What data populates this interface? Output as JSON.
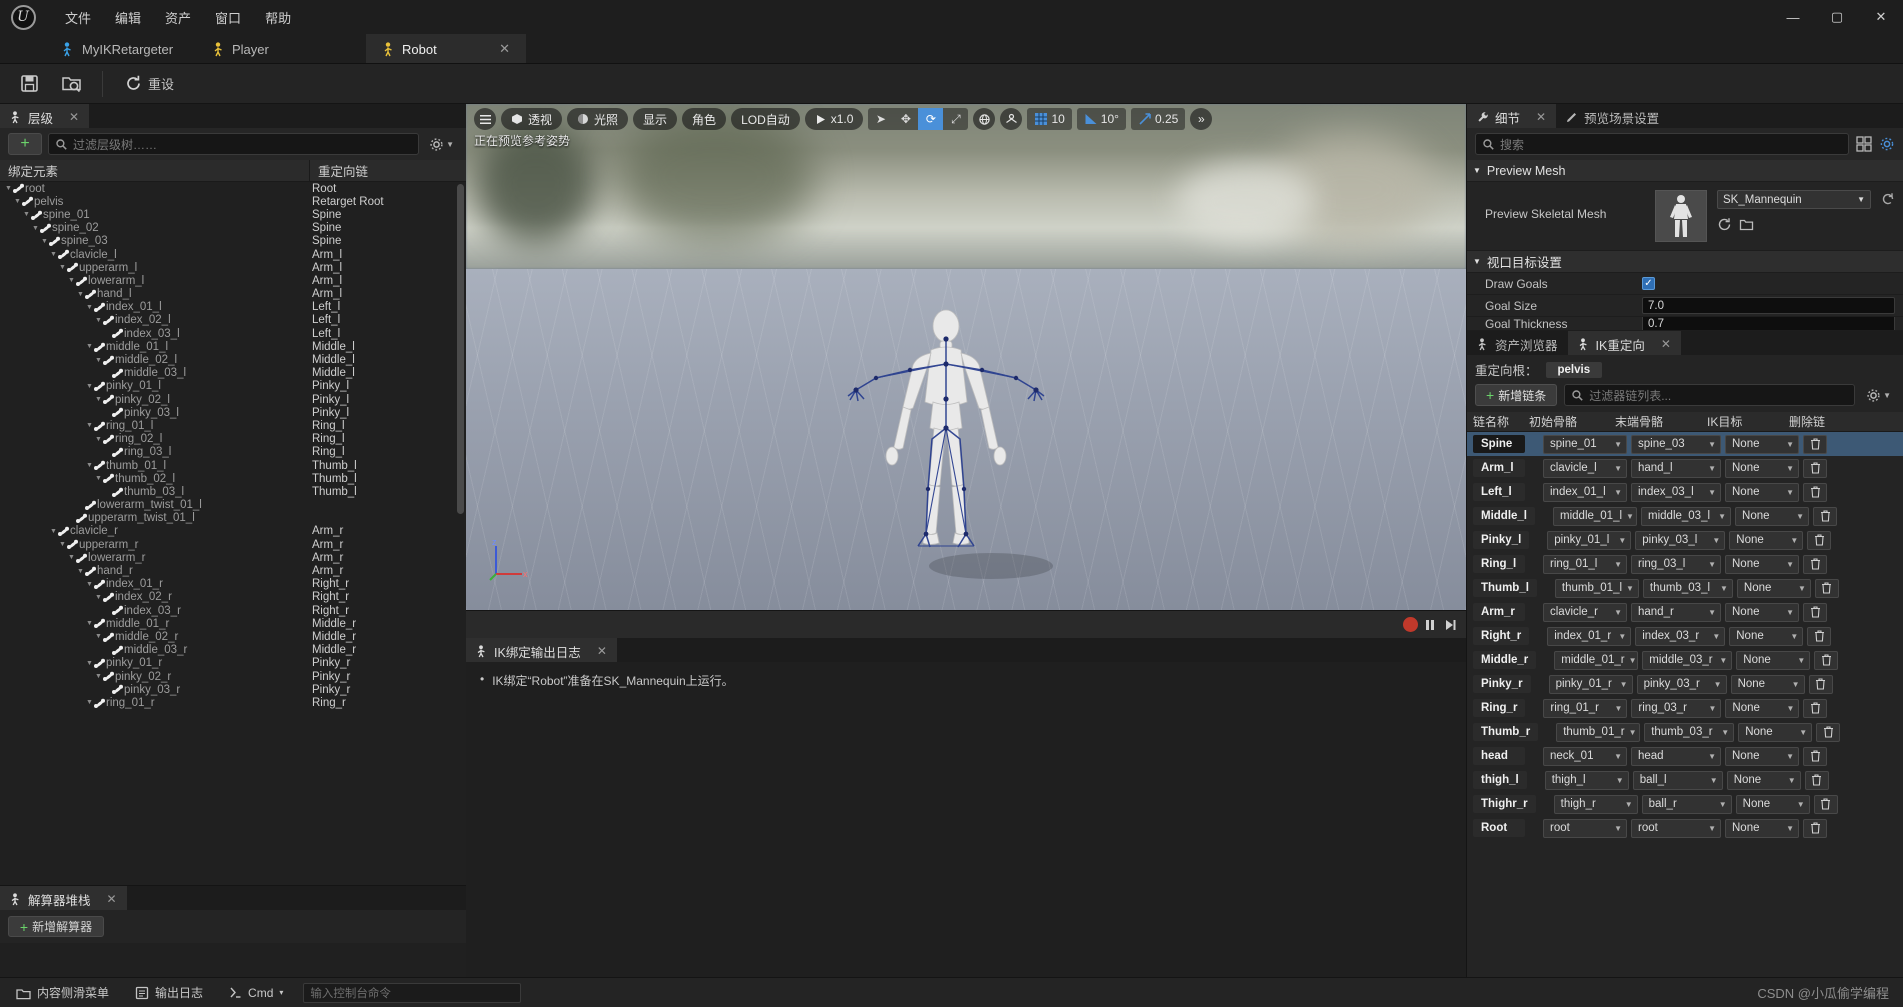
{
  "window": {
    "minimize": "—",
    "maximize": "▢",
    "close": "✕"
  },
  "menu": {
    "items": [
      {
        "label": "文件",
        "name": "menu-file"
      },
      {
        "label": "编辑",
        "name": "menu-edit"
      },
      {
        "label": "资产",
        "name": "menu-asset"
      },
      {
        "label": "窗口",
        "name": "menu-window"
      },
      {
        "label": "帮助",
        "name": "menu-help"
      }
    ]
  },
  "editor_tabs": [
    {
      "label": "MyIKRetargeter",
      "icon": "person-blue-icon",
      "active": false,
      "color": "#3aa2e8"
    },
    {
      "label": "Player",
      "icon": "person-yellow-icon",
      "active": false,
      "color": "#e8c13a"
    },
    {
      "label": "Robot",
      "icon": "person-yellow-icon",
      "active": true,
      "color": "#e8c13a",
      "close": "✕"
    }
  ],
  "toolbar": {
    "save_icon": "save-icon",
    "browse_icon": "browse-content-icon",
    "reset_label": "重设",
    "reset_icon": "refresh-icon"
  },
  "hierarchy": {
    "tab_label": "层级",
    "tab_close": "✕",
    "add_label": "+",
    "filter_placeholder": "过滤层级树……",
    "settings_icon": "gear-icon",
    "columns": {
      "element": "绑定元素",
      "chain": "重定向链"
    },
    "rows": [
      {
        "depth": 0,
        "name": "root",
        "chain": "Root",
        "expandable": true
      },
      {
        "depth": 1,
        "name": "pelvis",
        "chain": "Retarget Root",
        "expandable": true
      },
      {
        "depth": 2,
        "name": "spine_01",
        "chain": "Spine",
        "expandable": true
      },
      {
        "depth": 3,
        "name": "spine_02",
        "chain": "Spine",
        "expandable": true
      },
      {
        "depth": 4,
        "name": "spine_03",
        "chain": "Spine",
        "expandable": true
      },
      {
        "depth": 5,
        "name": "clavicle_l",
        "chain": "Arm_l",
        "expandable": true
      },
      {
        "depth": 6,
        "name": "upperarm_l",
        "chain": "Arm_l",
        "expandable": true
      },
      {
        "depth": 7,
        "name": "lowerarm_l",
        "chain": "Arm_l",
        "expandable": true
      },
      {
        "depth": 8,
        "name": "hand_l",
        "chain": "Arm_l",
        "expandable": true
      },
      {
        "depth": 9,
        "name": "index_01_l",
        "chain": "Left_l",
        "expandable": true
      },
      {
        "depth": 10,
        "name": "index_02_l",
        "chain": "Left_l",
        "expandable": true
      },
      {
        "depth": 11,
        "name": "index_03_l",
        "chain": "Left_l",
        "expandable": false
      },
      {
        "depth": 9,
        "name": "middle_01_l",
        "chain": "Middle_l",
        "expandable": true
      },
      {
        "depth": 10,
        "name": "middle_02_l",
        "chain": "Middle_l",
        "expandable": true
      },
      {
        "depth": 11,
        "name": "middle_03_l",
        "chain": "Middle_l",
        "expandable": false
      },
      {
        "depth": 9,
        "name": "pinky_01_l",
        "chain": "Pinky_l",
        "expandable": true
      },
      {
        "depth": 10,
        "name": "pinky_02_l",
        "chain": "Pinky_l",
        "expandable": true
      },
      {
        "depth": 11,
        "name": "pinky_03_l",
        "chain": "Pinky_l",
        "expandable": false
      },
      {
        "depth": 9,
        "name": "ring_01_l",
        "chain": "Ring_l",
        "expandable": true
      },
      {
        "depth": 10,
        "name": "ring_02_l",
        "chain": "Ring_l",
        "expandable": true
      },
      {
        "depth": 11,
        "name": "ring_03_l",
        "chain": "Ring_l",
        "expandable": false
      },
      {
        "depth": 9,
        "name": "thumb_01_l",
        "chain": "Thumb_l",
        "expandable": true
      },
      {
        "depth": 10,
        "name": "thumb_02_l",
        "chain": "Thumb_l",
        "expandable": true
      },
      {
        "depth": 11,
        "name": "thumb_03_l",
        "chain": "Thumb_l",
        "expandable": false
      },
      {
        "depth": 8,
        "name": "lowerarm_twist_01_l",
        "chain": "",
        "expandable": false
      },
      {
        "depth": 7,
        "name": "upperarm_twist_01_l",
        "chain": "",
        "expandable": false
      },
      {
        "depth": 5,
        "name": "clavicle_r",
        "chain": "Arm_r",
        "expandable": true
      },
      {
        "depth": 6,
        "name": "upperarm_r",
        "chain": "Arm_r",
        "expandable": true
      },
      {
        "depth": 7,
        "name": "lowerarm_r",
        "chain": "Arm_r",
        "expandable": true
      },
      {
        "depth": 8,
        "name": "hand_r",
        "chain": "Arm_r",
        "expandable": true
      },
      {
        "depth": 9,
        "name": "index_01_r",
        "chain": "Right_r",
        "expandable": true
      },
      {
        "depth": 10,
        "name": "index_02_r",
        "chain": "Right_r",
        "expandable": true
      },
      {
        "depth": 11,
        "name": "index_03_r",
        "chain": "Right_r",
        "expandable": false
      },
      {
        "depth": 9,
        "name": "middle_01_r",
        "chain": "Middle_r",
        "expandable": true
      },
      {
        "depth": 10,
        "name": "middle_02_r",
        "chain": "Middle_r",
        "expandable": true
      },
      {
        "depth": 11,
        "name": "middle_03_r",
        "chain": "Middle_r",
        "expandable": false
      },
      {
        "depth": 9,
        "name": "pinky_01_r",
        "chain": "Pinky_r",
        "expandable": true
      },
      {
        "depth": 10,
        "name": "pinky_02_r",
        "chain": "Pinky_r",
        "expandable": true
      },
      {
        "depth": 11,
        "name": "pinky_03_r",
        "chain": "Pinky_r",
        "expandable": false
      },
      {
        "depth": 9,
        "name": "ring_01_r",
        "chain": "Ring_r",
        "expandable": true
      }
    ]
  },
  "solver_stack": {
    "tab_label": "解算器堆栈",
    "tab_close": "✕",
    "add_solver_label": "新增解算器",
    "add_solver_icon": "plus-icon"
  },
  "viewport": {
    "status_text": "正在预览参考姿势",
    "menu_icon": "hamburger-icon",
    "perspective_label": "透视",
    "perspective_icon": "cube-icon",
    "lighting_label": "光照",
    "lighting_icon": "sphere-icon",
    "show_label": "显示",
    "character_label": "角色",
    "lod_label": "LOD自动",
    "play_rate": "x1.0",
    "play_icon": "play-icon",
    "gizmos": [
      {
        "name": "select-tool",
        "glyph": "➤",
        "active": false
      },
      {
        "name": "translate-tool",
        "glyph": "✥",
        "active": false
      },
      {
        "name": "rotate-tool",
        "glyph": "⟳",
        "active": true
      },
      {
        "name": "scale-tool",
        "glyph": "⤢",
        "active": false
      }
    ],
    "coord-space-icon": "globe-icon",
    "surface-snap-icon": "surface-snap-icon",
    "grid_snap_icon": "grid-icon",
    "grid_snap_value": "10",
    "rot_snap_icon": "angle-icon",
    "rot_snap_value": "10°",
    "scale_snap_icon": "scale-icon",
    "scale_snap_value": "0.25",
    "overflow": "»",
    "axis_x": "x",
    "axis_y": "",
    "axis_z": "z",
    "record_icon": "record-icon",
    "pause_icon": "pause-icon",
    "step_icon": "step-forward-icon"
  },
  "log": {
    "tab_label": "IK绑定输出日志",
    "tab_close": "✕",
    "entries": [
      "IK绑定“Robot”准备在SK_Mannequin上运行。"
    ]
  },
  "details": {
    "tab_label": "细节",
    "tab_close": "✕",
    "preview_tab_label": "预览场景设置",
    "search_placeholder": "搜索",
    "grid_icon": "grid-view-icon",
    "settings_icon": "settings-icon",
    "sections": [
      {
        "title": "Preview Mesh",
        "mesh_label": "Preview Skeletal Mesh",
        "mesh_value": "SK_Mannequin",
        "browse_icon": "browse-icon",
        "use_selected_icon": "use-selected-icon",
        "reset_icon": "reset-arrow-icon"
      },
      {
        "title": "视口目标设置",
        "rows": [
          {
            "label": "Draw Goals",
            "type": "checkbox",
            "value": "✓"
          },
          {
            "label": "Goal Size",
            "type": "text",
            "value": "7.0"
          },
          {
            "label": "Goal Thickness",
            "type": "text",
            "value": "0.7"
          }
        ]
      }
    ]
  },
  "chains": {
    "asset_browser_tab": "资产浏览器",
    "ik_retarget_tab": "IK重定向",
    "ik_retarget_tab_close": "✕",
    "retarget_root_label": "重定向根：",
    "retarget_root_value": "pelvis",
    "add_chain_label": "新增链条",
    "add_chain_icon": "plus-icon",
    "filter_placeholder": "过滤器链列表...",
    "settings_icon": "gear-icon",
    "columns": [
      "链名称",
      "初始骨骼",
      "末端骨骼",
      "IK目标",
      "删除链"
    ],
    "rows": [
      {
        "name": "Spine",
        "start": "spine_01",
        "end": "spine_03",
        "goal": "None",
        "selected": true
      },
      {
        "name": "Arm_l",
        "start": "clavicle_l",
        "end": "hand_l",
        "goal": "None",
        "selected": false
      },
      {
        "name": "Left_l",
        "start": "index_01_l",
        "end": "index_03_l",
        "goal": "None",
        "selected": false
      },
      {
        "name": "Middle_l",
        "start": "middle_01_l",
        "end": "middle_03_l",
        "goal": "None",
        "selected": false
      },
      {
        "name": "Pinky_l",
        "start": "pinky_01_l",
        "end": "pinky_03_l",
        "goal": "None",
        "selected": false
      },
      {
        "name": "Ring_l",
        "start": "ring_01_l",
        "end": "ring_03_l",
        "goal": "None",
        "selected": false
      },
      {
        "name": "Thumb_l",
        "start": "thumb_01_l",
        "end": "thumb_03_l",
        "goal": "None",
        "selected": false
      },
      {
        "name": "Arm_r",
        "start": "clavicle_r",
        "end": "hand_r",
        "goal": "None",
        "selected": false
      },
      {
        "name": "Right_r",
        "start": "index_01_r",
        "end": "index_03_r",
        "goal": "None",
        "selected": false
      },
      {
        "name": "Middle_r",
        "start": "middle_01_r",
        "end": "middle_03_r",
        "goal": "None",
        "selected": false
      },
      {
        "name": "Pinky_r",
        "start": "pinky_01_r",
        "end": "pinky_03_r",
        "goal": "None",
        "selected": false
      },
      {
        "name": "Ring_r",
        "start": "ring_01_r",
        "end": "ring_03_r",
        "goal": "None",
        "selected": false
      },
      {
        "name": "Thumb_r",
        "start": "thumb_01_r",
        "end": "thumb_03_r",
        "goal": "None",
        "selected": false
      },
      {
        "name": "head",
        "start": "neck_01",
        "end": "head",
        "goal": "None",
        "selected": false
      },
      {
        "name": "thigh_l",
        "start": "thigh_l",
        "end": "ball_l",
        "goal": "None",
        "selected": false
      },
      {
        "name": "Thighr_r",
        "start": "thigh_r",
        "end": "ball_r",
        "goal": "None",
        "selected": false
      },
      {
        "name": "Root",
        "start": "root",
        "end": "root",
        "goal": "None",
        "selected": false
      }
    ],
    "delete_icon": "trash-icon",
    "dropdown_caret": "▼"
  },
  "statusbar": {
    "content_drawer_label": "内容侧滑菜单",
    "content_drawer_icon": "drawer-icon",
    "output_log_label": "输出日志",
    "output_log_icon": "log-icon",
    "cmd_label": "Cmd",
    "cmd_caret": "▾",
    "cmd_placeholder": "输入控制台命令",
    "watermark": "CSDN @小瓜偷学编程"
  }
}
